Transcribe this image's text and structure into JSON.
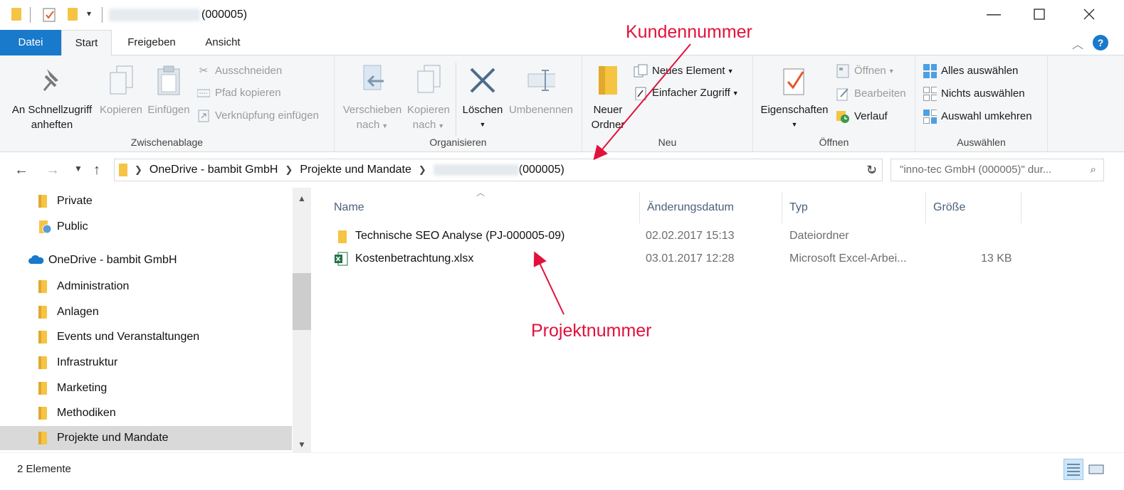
{
  "window": {
    "title_suffix": "(000005)"
  },
  "ribbon_tabs": [
    "Datei",
    "Start",
    "Freigeben",
    "Ansicht"
  ],
  "clipboard": {
    "pin_label_1": "An Schnellzugriff",
    "pin_label_2": "anheften",
    "copy_label": "Kopieren",
    "paste_label": "Einfügen",
    "cut_label": "Ausschneiden",
    "copy_path_label": "Pfad kopieren",
    "paste_shortcut_label": "Verknüpfung einfügen",
    "group_label": "Zwischenablage"
  },
  "organize": {
    "move_label_1": "Verschieben",
    "move_label_2": "nach",
    "copyto_label_1": "Kopieren",
    "copyto_label_2": "nach",
    "delete_label": "Löschen",
    "rename_label": "Umbenennen",
    "group_label": "Organisieren"
  },
  "new": {
    "new_folder_label_1": "Neuer",
    "new_folder_label_2": "Ordner",
    "new_item_label": "Neues Element",
    "easy_access_label": "Einfacher Zugriff",
    "group_label": "Neu"
  },
  "open": {
    "properties_label": "Eigenschaften",
    "open_label": "Öffnen",
    "edit_label": "Bearbeiten",
    "history_label": "Verlauf",
    "group_label": "Öffnen"
  },
  "select": {
    "select_all_label": "Alles auswählen",
    "select_none_label": "Nichts auswählen",
    "invert_label": "Auswahl umkehren",
    "group_label": "Auswählen"
  },
  "address": {
    "crumb_1": "OneDrive - bambit GmbH",
    "crumb_2": "Projekte und Mandate",
    "crumb_3_suffix": "(000005)",
    "search_placeholder": "\"inno-tec GmbH (000005)\" dur..."
  },
  "navpane": {
    "items": [
      "Private",
      "Public",
      "OneDrive - bambit GmbH",
      "Administration",
      "Anlagen",
      "Events und Veranstaltungen",
      "Infrastruktur",
      "Marketing",
      "Methodiken",
      "Projekte und Mandate"
    ]
  },
  "filelist": {
    "columns": [
      "Name",
      "Änderungsdatum",
      "Typ",
      "Größe"
    ],
    "rows": [
      {
        "name": "Technische SEO Analyse (PJ-000005-09)",
        "date": "02.02.2017 15:13",
        "type": "Dateiordner",
        "size": ""
      },
      {
        "name": "Kostenbetrachtung.xlsx",
        "date": "03.01.2017 12:28",
        "type": "Microsoft Excel-Arbei...",
        "size": "13 KB"
      }
    ]
  },
  "annotations": {
    "customer_number": "Kundennummer",
    "project_number": "Projektnummer",
    "color": "#e2113c"
  },
  "status": {
    "item_count": "2 Elemente"
  }
}
